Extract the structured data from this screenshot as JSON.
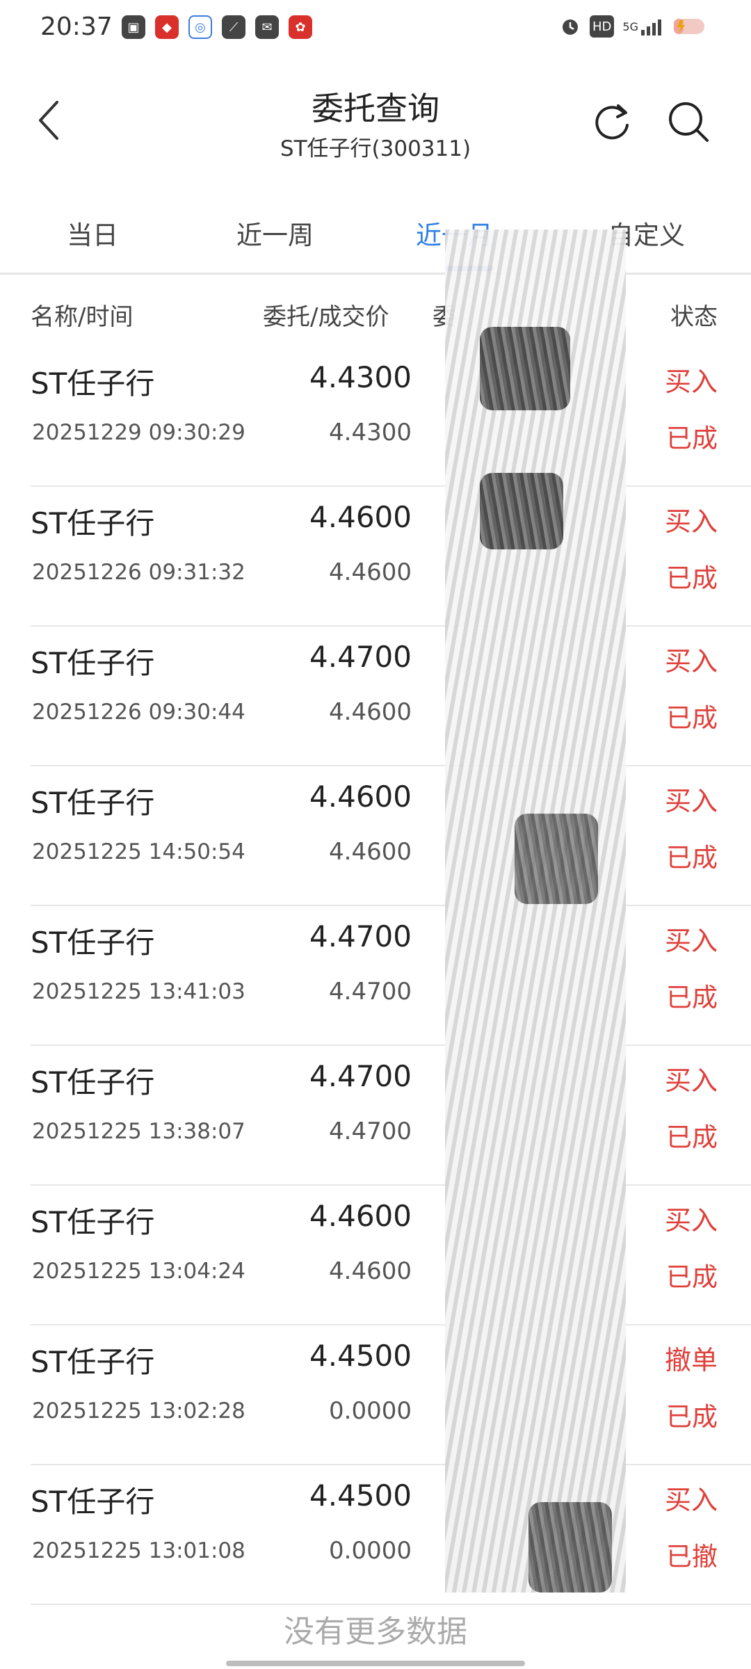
{
  "status_bar": {
    "time": "20:37",
    "network": "5G",
    "hd": "HD"
  },
  "header": {
    "title": "委托查询",
    "subtitle": "ST任子行(300311)"
  },
  "tabs": [
    {
      "label": "当日",
      "active": false
    },
    {
      "label": "近一周",
      "active": false
    },
    {
      "label": "近一月",
      "active": true
    },
    {
      "label": "自定义",
      "active": false
    }
  ],
  "columns": {
    "name_time": "名称/时间",
    "price": "委托/成交价",
    "qty": "委",
    "status": "状态"
  },
  "orders": [
    {
      "name": "ST任子行",
      "time": "20251229 09:30:29",
      "price": "4.4300",
      "deal": "4.4300",
      "direction": "买入",
      "status": "已成"
    },
    {
      "name": "ST任子行",
      "time": "20251226 09:31:32",
      "price": "4.4600",
      "deal": "4.4600",
      "direction": "买入",
      "status": "已成"
    },
    {
      "name": "ST任子行",
      "time": "20251226 09:30:44",
      "price": "4.4700",
      "deal": "4.4600",
      "direction": "买入",
      "status": "已成"
    },
    {
      "name": "ST任子行",
      "time": "20251225 14:50:54",
      "price": "4.4600",
      "deal": "4.4600",
      "direction": "买入",
      "status": "已成"
    },
    {
      "name": "ST任子行",
      "time": "20251225 13:41:03",
      "price": "4.4700",
      "deal": "4.4700",
      "direction": "买入",
      "status": "已成"
    },
    {
      "name": "ST任子行",
      "time": "20251225 13:38:07",
      "price": "4.4700",
      "deal": "4.4700",
      "direction": "买入",
      "status": "已成"
    },
    {
      "name": "ST任子行",
      "time": "20251225 13:04:24",
      "price": "4.4600",
      "deal": "4.4600",
      "direction": "买入",
      "status": "已成"
    },
    {
      "name": "ST任子行",
      "time": "20251225 13:02:28",
      "price": "4.4500",
      "deal": "0.0000",
      "direction": "撤单",
      "status": "已成"
    },
    {
      "name": "ST任子行",
      "time": "20251225 13:01:08",
      "price": "4.4500",
      "deal": "0.0000",
      "direction": "买入",
      "status": "已撤"
    }
  ],
  "footer": "没有更多数据",
  "colors": {
    "accent": "#2f7fe6",
    "buy_red": "#e0403a"
  }
}
